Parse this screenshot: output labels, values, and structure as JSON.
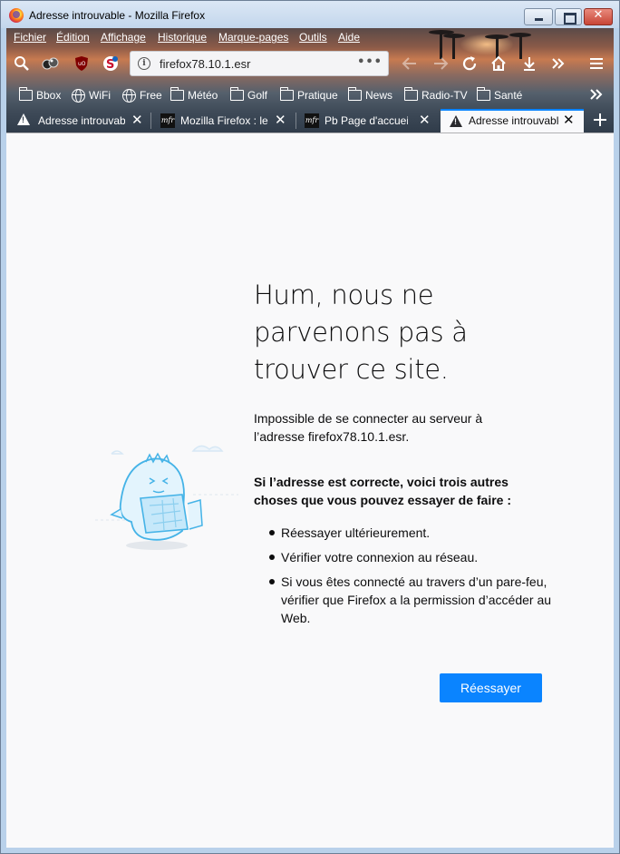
{
  "window": {
    "title": "Adresse introuvable - Mozilla Firefox"
  },
  "menubar": {
    "items": [
      {
        "label": "Fichier"
      },
      {
        "label": "Édition"
      },
      {
        "label": "Affichage"
      },
      {
        "label": "Historique"
      },
      {
        "label": "Marque-pages"
      },
      {
        "label": "Outils"
      },
      {
        "label": "Aide"
      }
    ]
  },
  "urlbar": {
    "url": "firefox78.10.1.esr",
    "more": "•••"
  },
  "bookmarks": {
    "items": [
      {
        "label": "Bbox",
        "icon": "folder-icon"
      },
      {
        "label": "WiFi",
        "icon": "globe-icon"
      },
      {
        "label": "Free",
        "icon": "globe-icon"
      },
      {
        "label": "Météo",
        "icon": "folder-icon"
      },
      {
        "label": "Golf",
        "icon": "folder-icon"
      },
      {
        "label": "Pratique",
        "icon": "folder-icon"
      },
      {
        "label": "News",
        "icon": "folder-icon"
      },
      {
        "label": "Radio-TV",
        "icon": "folder-icon"
      },
      {
        "label": "Santé",
        "icon": "folder-icon"
      }
    ]
  },
  "tabs": [
    {
      "label": "Adresse introuvable",
      "icon": "warning-icon",
      "active": false
    },
    {
      "label": "Mozilla Firefox : le",
      "icon": "mfr-icon",
      "active": false
    },
    {
      "label": "Pb Page d'accueil",
      "icon": "mfr-icon",
      "active": false
    },
    {
      "label": "Adresse introuvable",
      "icon": "warning-icon",
      "active": true
    }
  ],
  "error": {
    "title": "Hum, nous ne parvenons pas à trouver ce site.",
    "description": "Impossible de se connecter au serveur à l’adresse firefox78.10.1.esr.",
    "suggestions_heading": "Si l’adresse est correcte, voici trois autres choses que vous pouvez essayer de faire :",
    "suggestions": [
      "Réessayer ultérieurement.",
      "Vérifier votre connexion au réseau.",
      "Si vous êtes connecté au travers d’un pare-feu, vérifier que Firefox a la permission d’accéder au Web."
    ],
    "retry_label": "Réessayer"
  },
  "colors": {
    "accent": "#0a84ff",
    "content_bg": "#f9f9fa",
    "text": "#0c0c0d"
  }
}
